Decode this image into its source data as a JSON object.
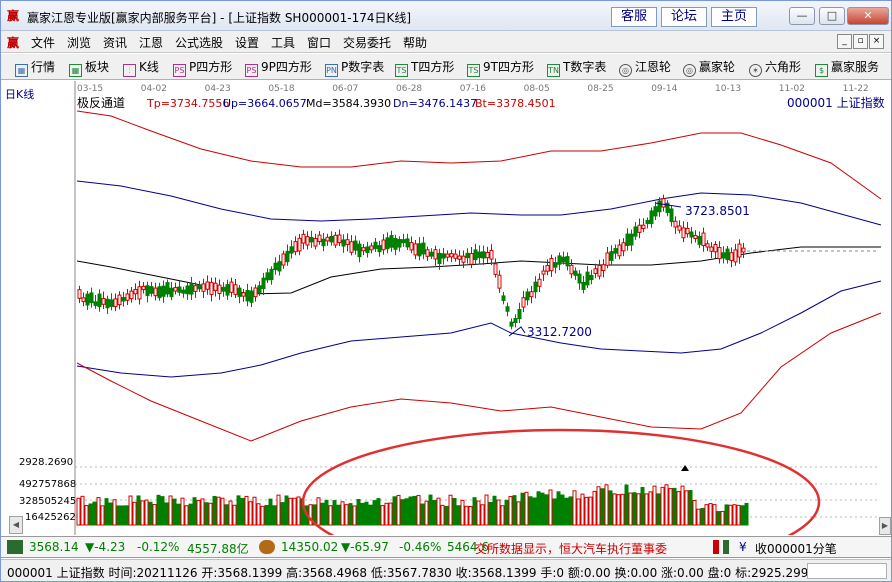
{
  "title_bar": {
    "app_icon": "赢",
    "title": "赢家江恩专业版[赢家内部服务平台] - [上证指数  SH000001-174日K线]",
    "links": [
      "客服",
      "论坛",
      "主页"
    ],
    "buttons": {
      "minimize": "—",
      "maximize": "□",
      "close": "✕"
    }
  },
  "menu": {
    "logo": "赢",
    "items": [
      "文件",
      "浏览",
      "资讯",
      "江恩",
      "公式选股",
      "设置",
      "工具",
      "窗口",
      "交易委托",
      "帮助"
    ],
    "mdi": [
      "_",
      "▫",
      "×"
    ]
  },
  "toolbar": {
    "items": [
      {
        "icon": "grid-icon",
        "glyph": "▦",
        "label": "行情"
      },
      {
        "icon": "blocks-icon",
        "glyph": "▦",
        "label": "板块"
      },
      {
        "icon": "kline-icon",
        "glyph": "⫶",
        "label": "K线"
      },
      {
        "icon": "ps-icon",
        "glyph": "PS",
        "label": "P四方形"
      },
      {
        "icon": "9ps-icon",
        "glyph": "PS",
        "label": "9P四方形"
      },
      {
        "icon": "pn-icon",
        "glyph": "PN",
        "label": "P数字表"
      },
      {
        "icon": "ts-icon",
        "glyph": "TS",
        "label": "T四方形"
      },
      {
        "icon": "9ts-icon",
        "glyph": "TS",
        "label": "9T四方形"
      },
      {
        "icon": "tn-icon",
        "glyph": "TN",
        "label": "T数字表"
      },
      {
        "icon": "gann-wheel-icon",
        "glyph": "◎",
        "label": "江恩轮"
      },
      {
        "icon": "winner-wheel-icon",
        "glyph": "◎",
        "label": "赢家轮"
      },
      {
        "icon": "hexagon-icon",
        "glyph": "✶",
        "label": "六角形"
      },
      {
        "icon": "service-icon",
        "glyph": "$",
        "label": "赢家服务"
      }
    ]
  },
  "chart": {
    "period_label": "日K线",
    "indicator_title": "极反通道",
    "tp": "Tp=3734.7556",
    "up": "Up=3664.0657",
    "md": "Md=3584.3930",
    "dn": "Dn=3476.1437",
    "bt": "Bt=3378.4501",
    "symbol": "000001 上证指数",
    "date_ticks": [
      "03-15",
      "04-02",
      "04-23",
      "05-18",
      "06-07",
      "06-28",
      "07-16",
      "08-05",
      "08-25",
      "09-14",
      "10-13",
      "11-02",
      "11-22"
    ],
    "high_annotation": "3723.8501",
    "low_annotation": "3312.7200",
    "volume_ticks": [
      "2928.2690",
      "492757868",
      "328505245",
      "164252623"
    ],
    "colors": {
      "up": "#d40000",
      "down": "#008000",
      "outer_band": "#cc0000",
      "inner_band": "#00008b",
      "mid": "#000000",
      "annotation": "#00008b",
      "ellipse": "#e03030"
    },
    "ellipse_overlay": true
  },
  "chart_data": {
    "type": "candlestick",
    "title": "极反通道",
    "x": [
      "03-15",
      "04-02",
      "04-23",
      "05-18",
      "06-07",
      "06-28",
      "07-16",
      "08-05",
      "08-25",
      "09-14",
      "10-13",
      "11-02",
      "11-22"
    ],
    "series": [
      {
        "name": "Tp",
        "values": [
          3734.7556
        ]
      },
      {
        "name": "Up",
        "values": [
          3664.0657
        ]
      },
      {
        "name": "Md",
        "values": [
          3584.393
        ]
      },
      {
        "name": "Dn",
        "values": [
          3476.1437
        ]
      },
      {
        "name": "Bt",
        "values": [
          3378.4501
        ]
      }
    ],
    "annotations": [
      {
        "label": "3723.8501",
        "kind": "high"
      },
      {
        "label": "3312.7200",
        "kind": "low"
      }
    ]
  },
  "quote_bar": {
    "index1_price": "3568.14",
    "index1_change": "▼-4.23",
    "index1_pct": "-0.12%",
    "index1_amount": "4557.88亿",
    "index2_price": "14350.02",
    "index2_change": "▼-65.97",
    "index2_pct": "-0.46%",
    "index2_amount": "5464.6",
    "news": "交所数据显示，恒大汽车执行董事委",
    "right_label": "收000001分笔"
  },
  "status": {
    "text": "000001 上证指数 时间:20211126 开:3568.1399 高:3568.4968 低:3567.7830 收:3568.1399 手:0 额:0.00 换:0.00 涨:0.00 盘:0 标:2925.2999"
  }
}
